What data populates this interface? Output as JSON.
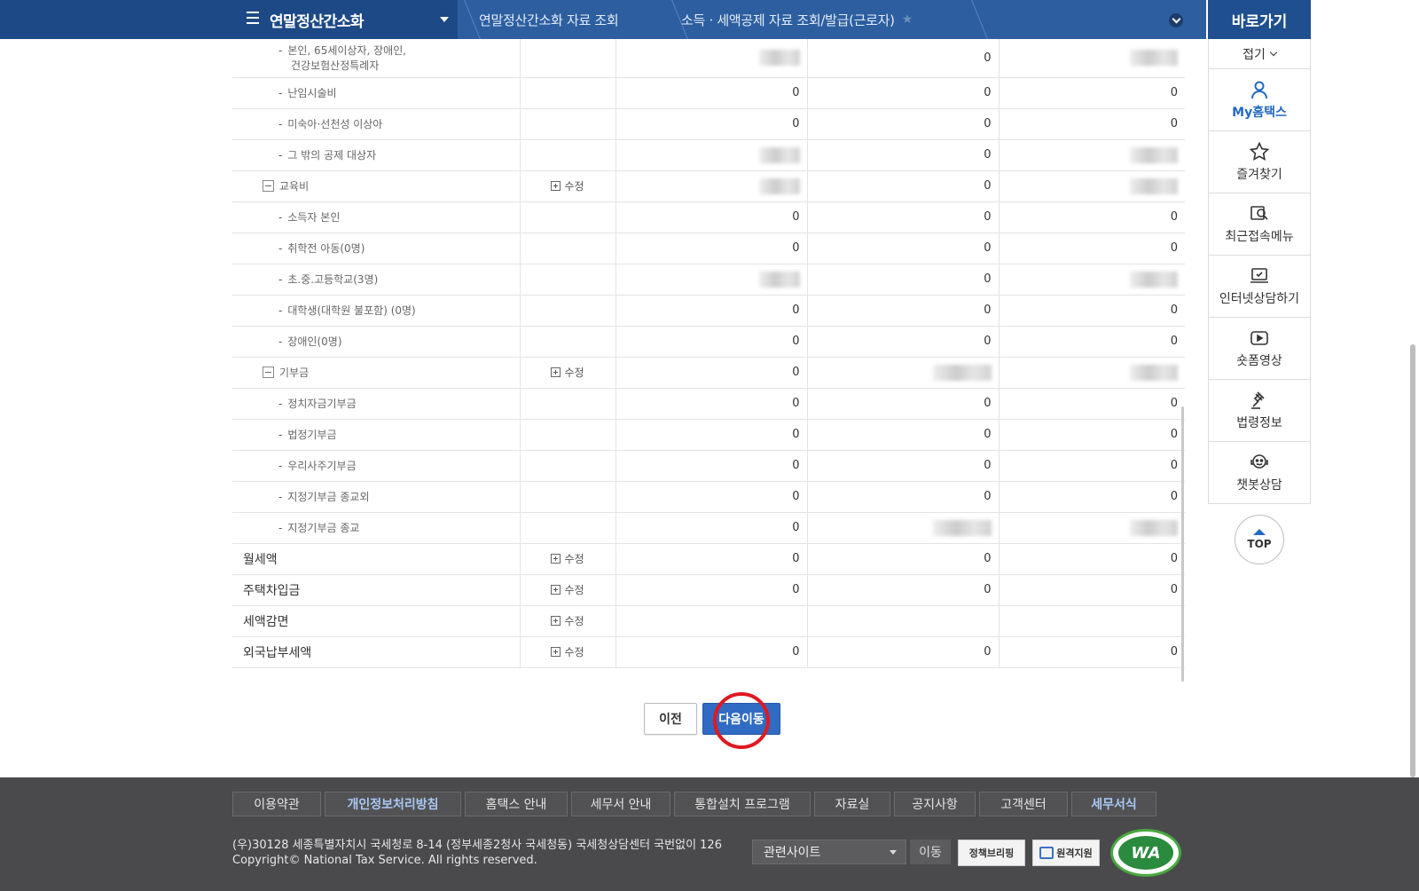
{
  "header": {
    "menu_title": "연말정산간소화",
    "crumb1": "연말정산간소화 자료 조회",
    "crumb2": "소득 · 세액공제 자료 조회/발급(근로자)"
  },
  "quick_menu": {
    "title": "바로가기",
    "fold": "접기",
    "items": [
      {
        "label": "My홈택스",
        "icon": "user-icon"
      },
      {
        "label": "즐겨찾기",
        "icon": "star-icon"
      },
      {
        "label": "최근접속메뉴",
        "icon": "recent-search-icon"
      },
      {
        "label": "인터넷상담하기",
        "icon": "laptop-check-icon"
      },
      {
        "label": "숏폼영상",
        "icon": "play-icon"
      },
      {
        "label": "법령정보",
        "icon": "gavel-icon"
      },
      {
        "label": "챗봇상담",
        "icon": "chatbot-icon"
      }
    ],
    "top": "TOP"
  },
  "table": {
    "rows": [
      {
        "label": "본인, 65세이상자, 장애인,",
        "label2": "건강보험산정특례자",
        "type": "sub",
        "edit": "",
        "c1": "",
        "c2": "0",
        "c3": "",
        "blur1": true,
        "blur3": true
      },
      {
        "label": "난임시술비",
        "type": "sub",
        "edit": "",
        "c1": "0",
        "c2": "0",
        "c3": "0"
      },
      {
        "label": "미숙아·선천성 이상아",
        "type": "sub",
        "edit": "",
        "c1": "0",
        "c2": "0",
        "c3": "0"
      },
      {
        "label": "그 밖의 공제 대상자",
        "type": "sub",
        "edit": "",
        "c1": "",
        "c2": "0",
        "c3": "",
        "blur1": true,
        "blur3": true
      },
      {
        "label": "교육비",
        "type": "group",
        "edit": "수정",
        "c1": "",
        "c2": "0",
        "c3": "",
        "blur1": true,
        "blur3": true
      },
      {
        "label": "소득자 본인",
        "type": "sub",
        "edit": "",
        "c1": "0",
        "c2": "0",
        "c3": "0"
      },
      {
        "label": "취학전 아동(0명)",
        "type": "sub",
        "edit": "",
        "c1": "0",
        "c2": "0",
        "c3": "0"
      },
      {
        "label": "초.중.고등학교(3명)",
        "type": "sub",
        "edit": "",
        "c1": "",
        "c2": "0",
        "c3": "",
        "blur1": true,
        "blur3": true
      },
      {
        "label": "대학생(대학원 불포함) (0명)",
        "type": "sub",
        "edit": "",
        "c1": "0",
        "c2": "0",
        "c3": "0"
      },
      {
        "label": "장애인(0명)",
        "type": "sub",
        "edit": "",
        "c1": "0",
        "c2": "0",
        "c3": "0"
      },
      {
        "label": "기부금",
        "type": "group",
        "edit": "수정",
        "c1": "0",
        "c2": "",
        "c3": "",
        "blur2": true,
        "blur3": true
      },
      {
        "label": "정치자금기부금",
        "type": "sub",
        "edit": "",
        "c1": "0",
        "c2": "0",
        "c3": "0"
      },
      {
        "label": "법정기부금",
        "type": "sub",
        "edit": "",
        "c1": "0",
        "c2": "0",
        "c3": "0"
      },
      {
        "label": "우리사주기부금",
        "type": "sub",
        "edit": "",
        "c1": "0",
        "c2": "0",
        "c3": "0"
      },
      {
        "label": "지정기부금 종교외",
        "type": "sub",
        "edit": "",
        "c1": "0",
        "c2": "0",
        "c3": "0"
      },
      {
        "label": "지정기부금 종교",
        "type": "sub",
        "edit": "",
        "c1": "0",
        "c2": "",
        "c3": "",
        "blur2": true,
        "blur3": true
      },
      {
        "label": "월세액",
        "type": "main",
        "edit": "수정",
        "c1": "0",
        "c2": "0",
        "c3": "0"
      },
      {
        "label": "주택차입금",
        "type": "main",
        "edit": "수정",
        "c1": "0",
        "c2": "0",
        "c3": "0"
      },
      {
        "label": "세액감면",
        "type": "main",
        "edit": "수정",
        "c1": "",
        "c2": "",
        "c3": ""
      },
      {
        "label": "외국납부세액",
        "type": "main",
        "edit": "수정",
        "c1": "0",
        "c2": "0",
        "c3": "0"
      }
    ]
  },
  "buttons": {
    "prev": "이전",
    "next": "다음이동"
  },
  "footer": {
    "links": [
      {
        "label": "이용약관",
        "bold": false
      },
      {
        "label": "개인정보처리방침",
        "bold": true
      },
      {
        "label": "홈택스 안내",
        "bold": false
      },
      {
        "label": "세무서 안내",
        "bold": false
      },
      {
        "label": "통합설치 프로그램",
        "bold": false
      },
      {
        "label": "자료실",
        "bold": false
      },
      {
        "label": "공지사항",
        "bold": false
      },
      {
        "label": "고객센터",
        "bold": false
      },
      {
        "label": "세무서식",
        "bold": true
      }
    ],
    "address": "(우)30128 세종특별자치시 국세청로 8-14 (정부세종2청사 국세청동) 국세청상담센터 국번없이 126",
    "copyright": "Copyright© National Tax Service. All rights reserved.",
    "related_site": "관련사이트",
    "go": "이동",
    "badge1": "정책브리핑",
    "badge2": "원격지원",
    "wa_label": "WA"
  },
  "colors": {
    "nav_bg": "#2d5fa0",
    "nav_dark": "#1d4a86",
    "next_button": "#2f6bc3",
    "highlight_circle": "#e0191f",
    "footer_bg": "#4a4a4c"
  }
}
